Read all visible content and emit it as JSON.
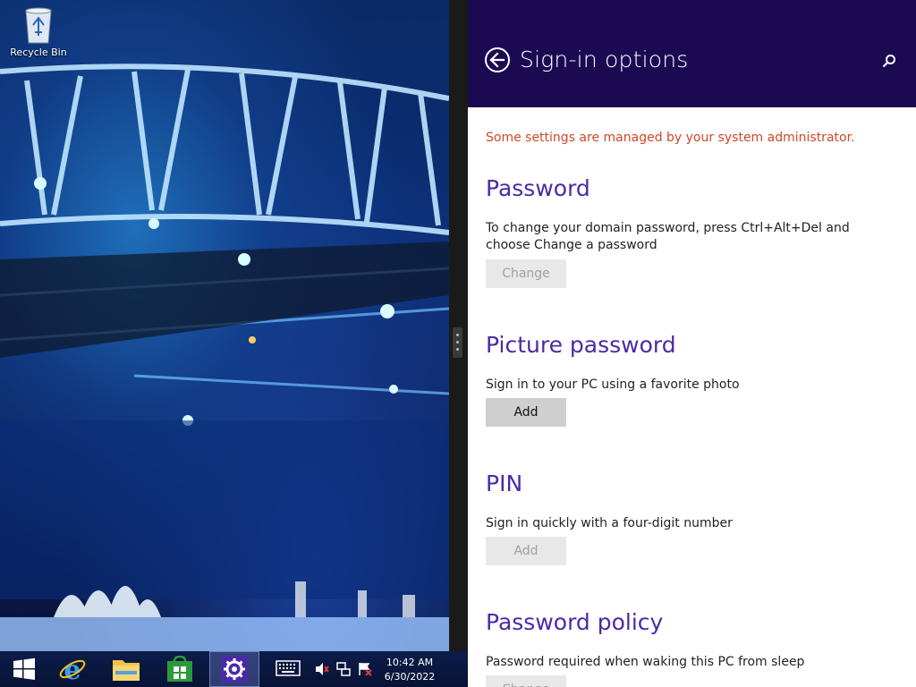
{
  "desktop": {
    "recycle_bin_label": "Recycle Bin"
  },
  "settings": {
    "title": "Sign-in options",
    "admin_notice": "Some settings are managed by your system administrator.",
    "sections": [
      {
        "title": "Password",
        "description": "To change your domain password, press Ctrl+Alt+Del and choose Change a password",
        "button_label": "Change",
        "button_enabled": false
      },
      {
        "title": "Picture password",
        "description": "Sign in to your PC using a favorite photo",
        "button_label": "Add",
        "button_enabled": true
      },
      {
        "title": "PIN",
        "description": "Sign in quickly with a four-digit number",
        "button_label": "Add",
        "button_enabled": false
      },
      {
        "title": "Password policy",
        "description": "Password required when waking this PC from sleep",
        "button_label": "Change",
        "button_enabled": false
      }
    ]
  },
  "taskbar": {
    "clock_time": "10:42 AM",
    "clock_date": "6/30/2022",
    "pinned": [
      "start-button",
      "internet-explorer",
      "file-explorer",
      "store",
      "pc-settings"
    ],
    "tray": [
      "touch-keyboard-icon",
      "volume-muted-icon",
      "network-icon",
      "action-center-flag-icon"
    ]
  },
  "colors": {
    "header_bg": "#1b0a52",
    "section_title": "#4b2aa6",
    "admin_notice": "#d24726",
    "taskbar_bg": "#0c1c4a"
  }
}
